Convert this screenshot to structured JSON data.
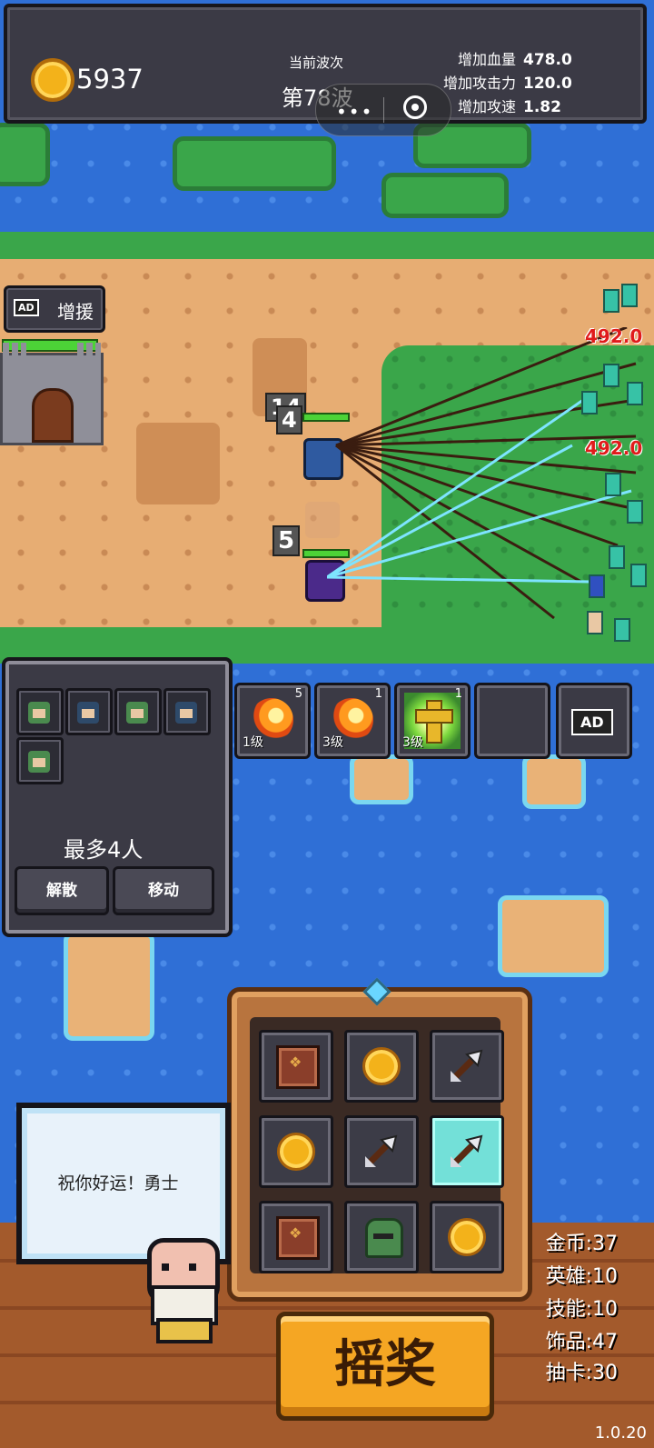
{
  "hud": {
    "gold": "5937",
    "wave_label": "当前波次",
    "wave_value": "第78波",
    "stats": [
      {
        "label": "增加血量",
        "value": "478.0"
      },
      {
        "label": "增加攻击力",
        "value": "120.0"
      },
      {
        "label": "增加攻速",
        "value": "1.82"
      }
    ]
  },
  "reinforce": {
    "ad": "AD",
    "label": "增援"
  },
  "battle": {
    "unit_levels": [
      "14",
      "4",
      "5"
    ],
    "damage_numbers": [
      "492.0",
      "492.0"
    ]
  },
  "team": {
    "max_label": "最多4人",
    "disband": "解散",
    "move": "移动"
  },
  "skills": [
    {
      "count": "5",
      "level": "1级",
      "icon": "fireball-icon"
    },
    {
      "count": "1",
      "level": "3级",
      "icon": "fireball-icon"
    },
    {
      "count": "1",
      "level": "3级",
      "icon": "holy-cross-icon"
    }
  ],
  "skill_ad": "AD",
  "machine": {
    "grid": [
      "chest",
      "coin",
      "arrow",
      "coin",
      "arrow",
      "arrow-highlight",
      "chest",
      "helmet",
      "coin"
    ]
  },
  "speech": "祝你好运！勇士",
  "spin_button": "摇奖",
  "costs": [
    "金币:37",
    "英雄:10",
    "技能:10",
    "饰品:47",
    "抽卡:30"
  ],
  "version": "1.0.20",
  "colors": {
    "hp_green": "#4cd337",
    "damage_red": "#e01b1b",
    "highlight": "#73e0d8",
    "spin_orange": "#f5a623"
  }
}
